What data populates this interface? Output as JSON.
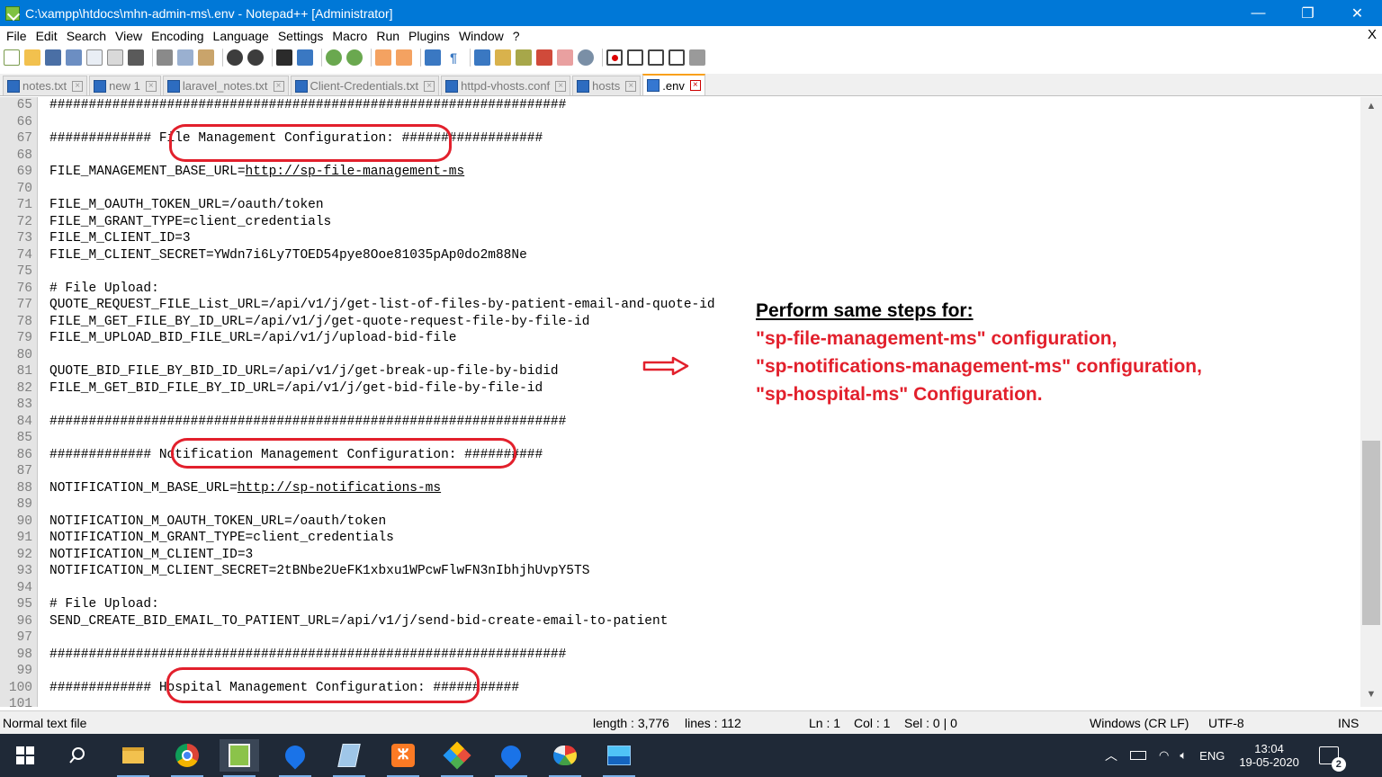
{
  "window": {
    "title": "C:\\xampp\\htdocs\\mhn-admin-ms\\.env - Notepad++ [Administrator]",
    "controls": [
      "—",
      "❐",
      "✕"
    ]
  },
  "menu": [
    "File",
    "Edit",
    "Search",
    "View",
    "Encoding",
    "Language",
    "Settings",
    "Macro",
    "Run",
    "Plugins",
    "Window",
    "?"
  ],
  "menu_close": "X",
  "tabs": [
    {
      "label": "notes.txt",
      "active": false
    },
    {
      "label": "new 1",
      "active": false
    },
    {
      "label": "laravel_notes.txt",
      "active": false
    },
    {
      "label": "Client-Credentials.txt",
      "active": false
    },
    {
      "label": "httpd-vhosts.conf",
      "active": false
    },
    {
      "label": "hosts",
      "active": false
    },
    {
      "label": ".env",
      "active": true
    }
  ],
  "editor": {
    "lines": [
      {
        "n": "65",
        "text": "##################################################################"
      },
      {
        "n": "66",
        "text": ""
      },
      {
        "n": "67",
        "text": "############# File Management Configuration: ##################"
      },
      {
        "n": "68",
        "text": ""
      },
      {
        "n": "69",
        "text": "FILE_MANAGEMENT_BASE_URL=",
        "url": "http://sp-file-management-ms"
      },
      {
        "n": "70",
        "text": ""
      },
      {
        "n": "71",
        "text": "FILE_M_OAUTH_TOKEN_URL=/oauth/token"
      },
      {
        "n": "72",
        "text": "FILE_M_GRANT_TYPE=client_credentials"
      },
      {
        "n": "73",
        "text": "FILE_M_CLIENT_ID=3"
      },
      {
        "n": "74",
        "text": "FILE_M_CLIENT_SECRET=YWdn7i6Ly7TOED54pye8Ooe81035pAp0do2m88Ne"
      },
      {
        "n": "75",
        "text": ""
      },
      {
        "n": "76",
        "text": "# File Upload:"
      },
      {
        "n": "77",
        "text": "QUOTE_REQUEST_FILE_List_URL=/api/v1/j/get-list-of-files-by-patient-email-and-quote-id"
      },
      {
        "n": "78",
        "text": "FILE_M_GET_FILE_BY_ID_URL=/api/v1/j/get-quote-request-file-by-file-id"
      },
      {
        "n": "79",
        "text": "FILE_M_UPLOAD_BID_FILE_URL=/api/v1/j/upload-bid-file"
      },
      {
        "n": "80",
        "text": ""
      },
      {
        "n": "81",
        "text": "QUOTE_BID_FILE_BY_BID_ID_URL=/api/v1/j/get-break-up-file-by-bidid"
      },
      {
        "n": "82",
        "text": "FILE_M_GET_BID_FILE_BY_ID_URL=/api/v1/j/get-bid-file-by-file-id"
      },
      {
        "n": "83",
        "text": ""
      },
      {
        "n": "84",
        "text": "##################################################################"
      },
      {
        "n": "85",
        "text": ""
      },
      {
        "n": "86",
        "text": "############# Notification Management Configuration: ##########"
      },
      {
        "n": "87",
        "text": ""
      },
      {
        "n": "88",
        "text": "NOTIFICATION_M_BASE_URL=",
        "url": "http://sp-notifications-ms"
      },
      {
        "n": "89",
        "text": ""
      },
      {
        "n": "90",
        "text": "NOTIFICATION_M_OAUTH_TOKEN_URL=/oauth/token"
      },
      {
        "n": "91",
        "text": "NOTIFICATION_M_GRANT_TYPE=client_credentials"
      },
      {
        "n": "92",
        "text": "NOTIFICATION_M_CLIENT_ID=3"
      },
      {
        "n": "93",
        "text": "NOTIFICATION_M_CLIENT_SECRET=2tBNbe2UeFK1xbxu1WPcwFlwFN3nIbhjhUvpY5TS"
      },
      {
        "n": "94",
        "text": ""
      },
      {
        "n": "95",
        "text": "# File Upload:"
      },
      {
        "n": "96",
        "text": "SEND_CREATE_BID_EMAIL_TO_PATIENT_URL=/api/v1/j/send-bid-create-email-to-patient"
      },
      {
        "n": "97",
        "text": ""
      },
      {
        "n": "98",
        "text": "##################################################################"
      },
      {
        "n": "99",
        "text": ""
      },
      {
        "n": "100",
        "text": "############# Hospital Management Configuration: ###########"
      },
      {
        "n": "101",
        "text": ""
      }
    ]
  },
  "annotation": {
    "heading": "Perform same steps for:",
    "items": [
      "\"sp-file-management-ms\" configuration,",
      "\"sp-notifications-management-ms\" configuration,",
      "\"sp-hospital-ms\" Configuration."
    ],
    "color": "#e2202c"
  },
  "status": {
    "file_type": "Normal text file",
    "length": "length : 3,776",
    "lines": "lines : 112",
    "ln": "Ln : 1",
    "col": "Col : 1",
    "sel": "Sel : 0 | 0",
    "eol": "Windows (CR LF)",
    "encoding": "UTF-8",
    "mode": "INS"
  },
  "taskbar": {
    "apps": [
      "start",
      "search",
      "file-explorer",
      "chrome",
      "notepad-plus-plus",
      "maps-pin",
      "notes-pencil",
      "xampp",
      "git-kraken",
      "maps-pin-2",
      "paint",
      "photos"
    ],
    "language": "ENG",
    "time": "13:04",
    "date": "19-05-2020",
    "notifications": "2"
  },
  "colors": {
    "titlebar": "#0078d7",
    "accent_red": "#e2202c",
    "taskbar": "#1f2937"
  }
}
